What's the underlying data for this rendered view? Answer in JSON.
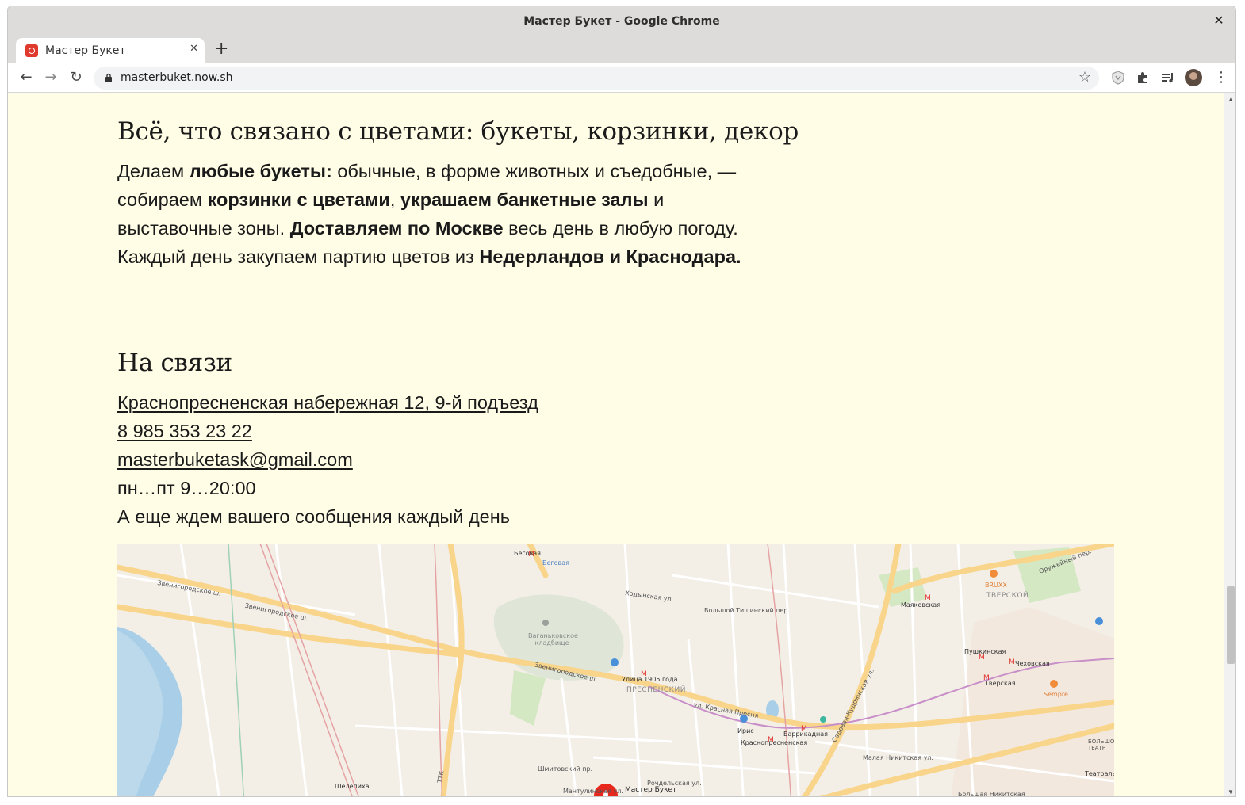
{
  "window": {
    "title": "Мастер Букет - Google Chrome",
    "close_glyph": "✕"
  },
  "tab": {
    "title": "Мастер Букет",
    "close_glyph": "✕"
  },
  "newtab_glyph": "+",
  "toolbar": {
    "back_glyph": "←",
    "forward_glyph": "→",
    "reload_glyph": "↻",
    "url": "masterbuket.now.sh",
    "star_glyph": "☆",
    "menu_glyph": "⋮"
  },
  "about": {
    "heading": "Всё, что связано с цветами: букеты, корзинки, декор",
    "p1": "Делаем ",
    "b1": "любые букеты:",
    "p2": " обычные, в форме животных и съедобные, — собираем ",
    "b2": "корзинки с цветами",
    "p3": ", ",
    "b3": "украшаем банкетные залы",
    "p4": " и выставочные зоны. ",
    "b4": "Доставляем по Москве",
    "p5": " весь день в любую погоду. Каждый день закупаем партию цветов из ",
    "b5": "Недерландов и Краснодара."
  },
  "contacts": {
    "heading": "На связи",
    "address": "Краснопресненская набережная 12, 9-й подъезд",
    "phone": "8 985 353 23 22",
    "email": "masterbuketask@gmail.com",
    "hours": "пн…пт 9…20:00",
    "note": "А еще ждем вашего сообщения каждый день"
  },
  "map": {
    "marker_label": "Мастер Букет",
    "labels": {
      "zvenigorodskoe_1": "Звенигородское ш.",
      "zvenigorodskoe_2": "Звенигородское ш.",
      "zvenigorodskoe_3": "Звенигородское ш.",
      "begovaya_1": "Беговая",
      "begovaya_2": "Беговая",
      "vagankovskoe": "Ваганьковское кладбище",
      "khodynskaya": "Ходынская ул.",
      "bolshoy_tishinsky": "Большой Тишинский пер.",
      "ulitsa_1905": "Улица 1905 года",
      "presnensky": "ПРЕСНЕНСКИЙ",
      "krasnaya_presnya": "ул. Красная Пресня",
      "iris": "Ирис",
      "krasnopresnenskaya": "Краснопресненская",
      "barrikadnaya": "Баррикадная",
      "mayakovskaya": "Маяковская",
      "tverskoy": "ТВЕРСКОЙ",
      "bruxx": "BRUXX",
      "pushkinskaya": "Пушкинская",
      "chekhovskaya": "Чеховская",
      "tverskaya": "Тверская",
      "sempre": "Sempre",
      "bolshoy_teatr": "БОЛЬШОЙ ТЕАТР",
      "teatralnaya": "Театральн",
      "shelepikha": "Шелепиха",
      "mantulinskaya": "Мантулинская ул.",
      "shmitovsky": "Шмитовский пр.",
      "rochdelskaya": "Рочдельская ул.",
      "malaya_nikitskaya": "Малая Никитская ул.",
      "bolshaya_nikitskaya": "Большая Никитская",
      "ttk": "ТТК",
      "oruzheyny": "Оружейный пер.",
      "sadovaya_kudrinskaya": "Садовая-Кудринская ул."
    },
    "colors": {
      "land": "#f3efe7",
      "water": "#a9cfe8",
      "park": "#d5e8c4",
      "cemetery": "#dfe6d8",
      "road_major": "#f8d58a",
      "road_minor": "#ffffff",
      "rail": "#e5a3a3",
      "metro_line": "#c88fc9",
      "marker": "#e8281d"
    }
  }
}
